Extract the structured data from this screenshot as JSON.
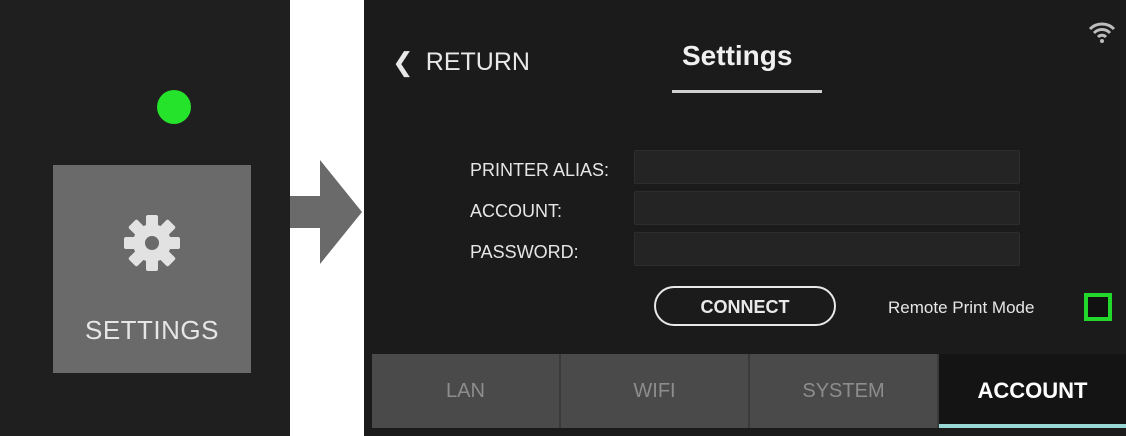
{
  "colors": {
    "status_dot": "#25e32a",
    "checkbox_border": "#22d82a",
    "active_tab_underline": "#9ad8d6"
  },
  "left_panel": {
    "tile": {
      "icon": "gear-icon",
      "label": "SETTINGS"
    }
  },
  "header": {
    "return_label": "RETURN",
    "return_icon": "chevron-left-icon",
    "title": "Settings",
    "status_icon": "wifi-icon"
  },
  "form": {
    "alias_label": "PRINTER ALIAS:",
    "alias_value": "",
    "account_label": "ACCOUNT:",
    "account_value": "",
    "password_label": "PASSWORD:",
    "password_value": ""
  },
  "actions": {
    "connect_label": "CONNECT",
    "remote_print_label": "Remote Print Mode",
    "remote_print_checked": false
  },
  "tabs": [
    {
      "label": "LAN",
      "active": false
    },
    {
      "label": "WIFI",
      "active": false
    },
    {
      "label": "SYSTEM",
      "active": false
    },
    {
      "label": "ACCOUNT",
      "active": true
    }
  ]
}
